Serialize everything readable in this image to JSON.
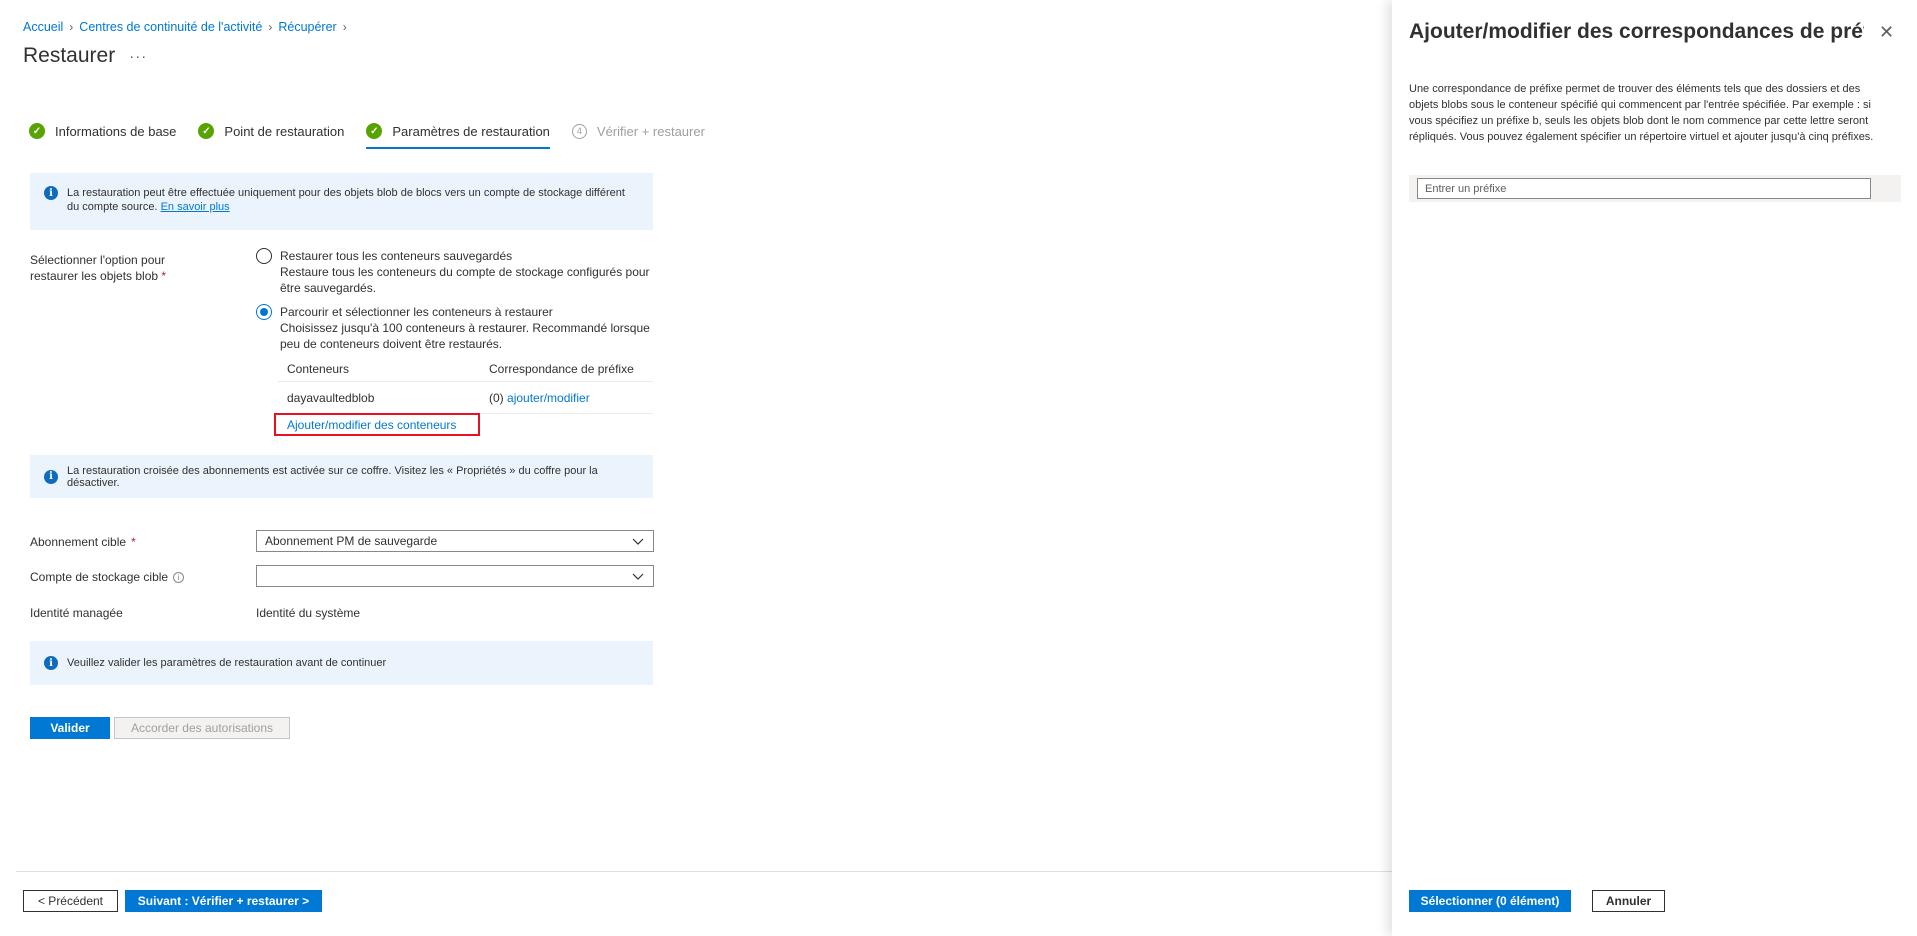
{
  "breadcrumb": [
    "Accueil",
    "Centres de continuité de l'activité",
    "Récupérer"
  ],
  "page": {
    "title": "Restaurer",
    "more": "···"
  },
  "steps": [
    {
      "label": "Informations de base",
      "state": "done"
    },
    {
      "label": "Point de restauration",
      "state": "done"
    },
    {
      "label": "Paramètres de restauration",
      "state": "done"
    },
    {
      "label": "Vérifier + restaurer",
      "state": "disabled",
      "number": "4"
    }
  ],
  "info_blob": {
    "text": "La restauration peut être effectuée uniquement pour des objets blob de blocs vers un compte de stockage différent du compte source.",
    "link": "En savoir plus"
  },
  "restore_option": {
    "label": "Sélectionner l'option pour restaurer les objets blob",
    "required": "*",
    "options": [
      {
        "title": "Restaurer tous les conteneurs sauvegardés",
        "desc": "Restaure tous les conteneurs du compte de stockage configurés pour être sauvegardés.",
        "selected": false
      },
      {
        "title": "Parcourir et sélectionner les conteneurs à restaurer",
        "desc": "Choisissez jusqu'à 100 conteneurs à restaurer. Recommandé lorsque peu de conteneurs doivent être restaurés.",
        "selected": true
      }
    ]
  },
  "containers_table": {
    "headers": [
      "Conteneurs",
      "Correspondance de préfixe"
    ],
    "rows": [
      {
        "name": "dayavaultedblob",
        "count": "(0)",
        "action": "ajouter/modifier"
      }
    ],
    "add_button": "Ajouter/modifier des conteneurs"
  },
  "info_cross_sub": {
    "text": "La restauration croisée des abonnements est activée sur ce coffre. Visitez les « Propriétés » du coffre pour la désactiver."
  },
  "target_subscription": {
    "label": "Abonnement cible",
    "required": "*",
    "value": "Abonnement PM de sauvegarde"
  },
  "target_storage": {
    "label": "Compte de stockage cible",
    "tooltip": "i",
    "value": ""
  },
  "managed_identity": {
    "label": "Identité managée",
    "value": "Identité du système"
  },
  "info_validate": {
    "text": "Veuillez valider les paramètres de restauration avant de continuer"
  },
  "actions": {
    "validate": "Valider",
    "grant": "Accorder des autorisations"
  },
  "footer": {
    "previous": "< Précédent",
    "next": "Suivant : Vérifier + restaurer >"
  },
  "panel": {
    "title": "Ajouter/modifier des correspondances de préf...",
    "description": "Une correspondance de préfixe permet de trouver des éléments tels que des dossiers et des objets blobs sous le conteneur spécifié qui commencent par l'entrée spécifiée. Par exemple : si vous spécifiez un préfixe b, seuls les objets blob dont le nom commence par cette lettre seront répliqués. Vous pouvez également spécifier un répertoire virtuel et ajouter jusqu'à cinq préfixes.",
    "prefix_placeholder": "Entrer un préfixe",
    "select_button": "Sélectionner (0 élément)",
    "cancel_button": "Annuler"
  },
  "colors": {
    "accent": "#0078d4",
    "success": "#57a300",
    "info_bg": "#ebf3fc",
    "highlight_border": "#e81123"
  }
}
